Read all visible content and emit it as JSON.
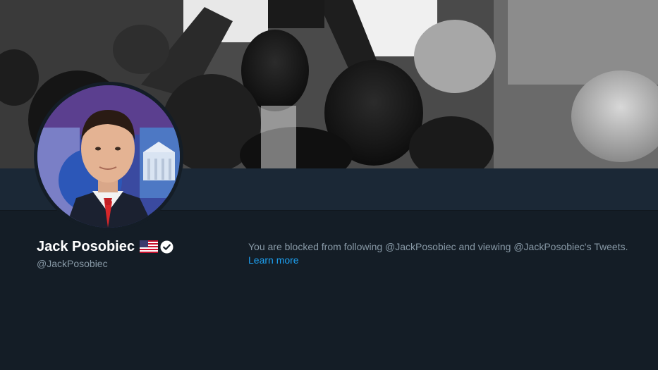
{
  "profile": {
    "display_name": "Jack Posobiec",
    "handle": "@JackPosobiec",
    "flag_icon": "us-flag-emoji-icon",
    "verified_icon": "verified-badge-icon"
  },
  "blocked_notice": {
    "message": "You are blocked from following @JackPosobiec and viewing @JackPosobiec's Tweets.",
    "link_label": "Learn more"
  },
  "colors": {
    "background": "#141d26",
    "navbar": "#1b2836",
    "link": "#1da1f2",
    "secondary_text": "#8899a6"
  }
}
